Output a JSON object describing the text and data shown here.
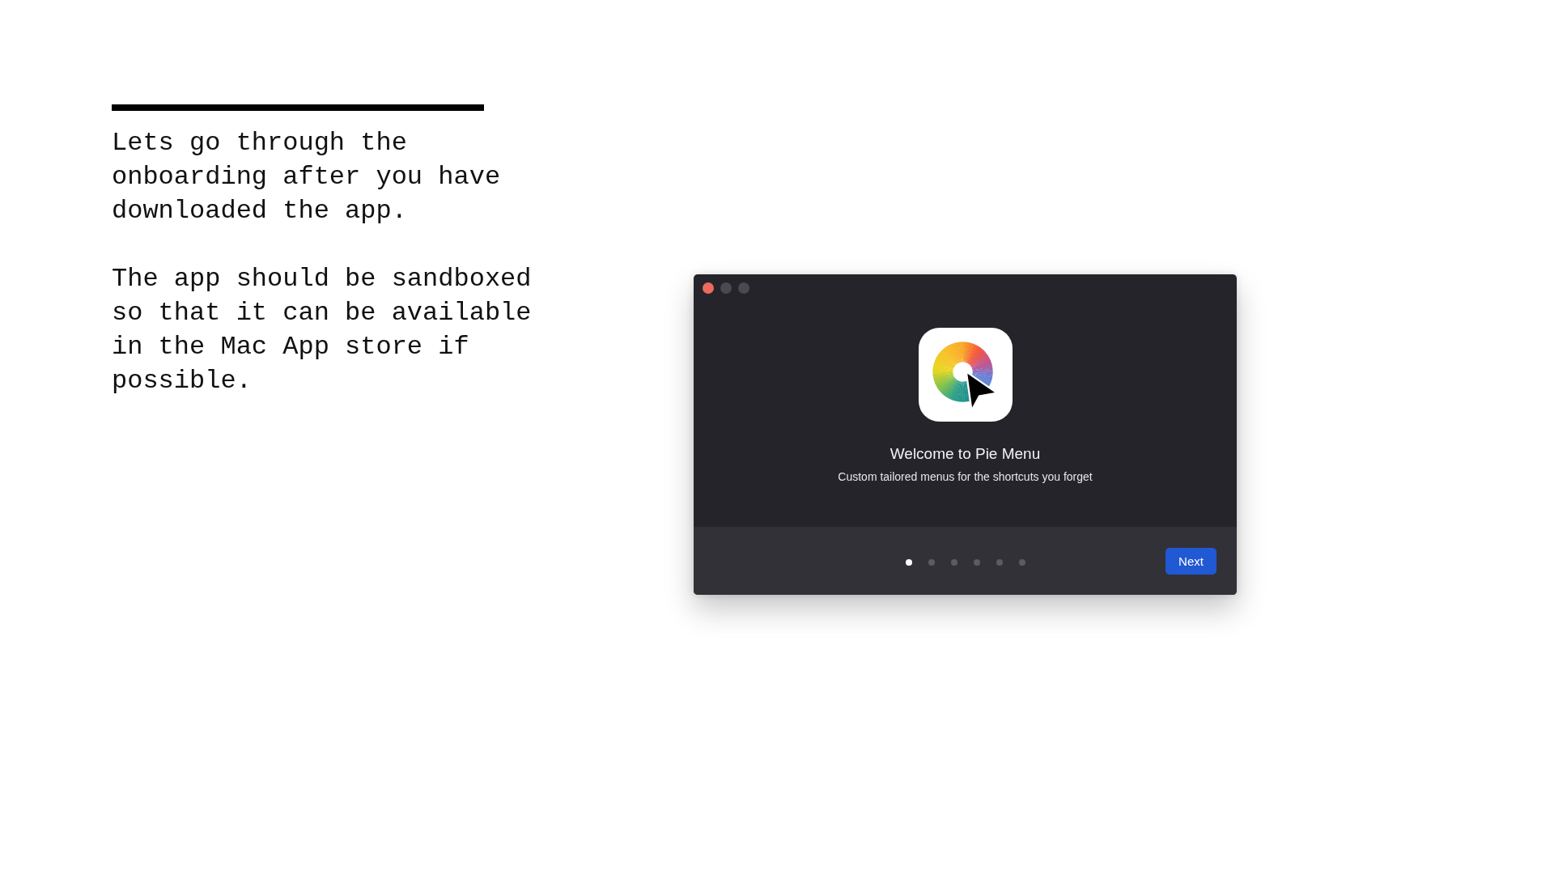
{
  "slide": {
    "paragraphs": [
      "Lets go through the onboarding after you have downloaded the app.",
      "The app should be sandboxed so that it can be available in the Mac App store if possible."
    ]
  },
  "window": {
    "title": "Welcome to Pie Menu",
    "subtitle": "Custom tailored menus for the shortcuts you forget",
    "pages": [
      {
        "selected": true
      },
      {
        "selected": false
      },
      {
        "selected": false
      },
      {
        "selected": false
      },
      {
        "selected": false
      },
      {
        "selected": false
      }
    ],
    "next_button": "Next"
  }
}
